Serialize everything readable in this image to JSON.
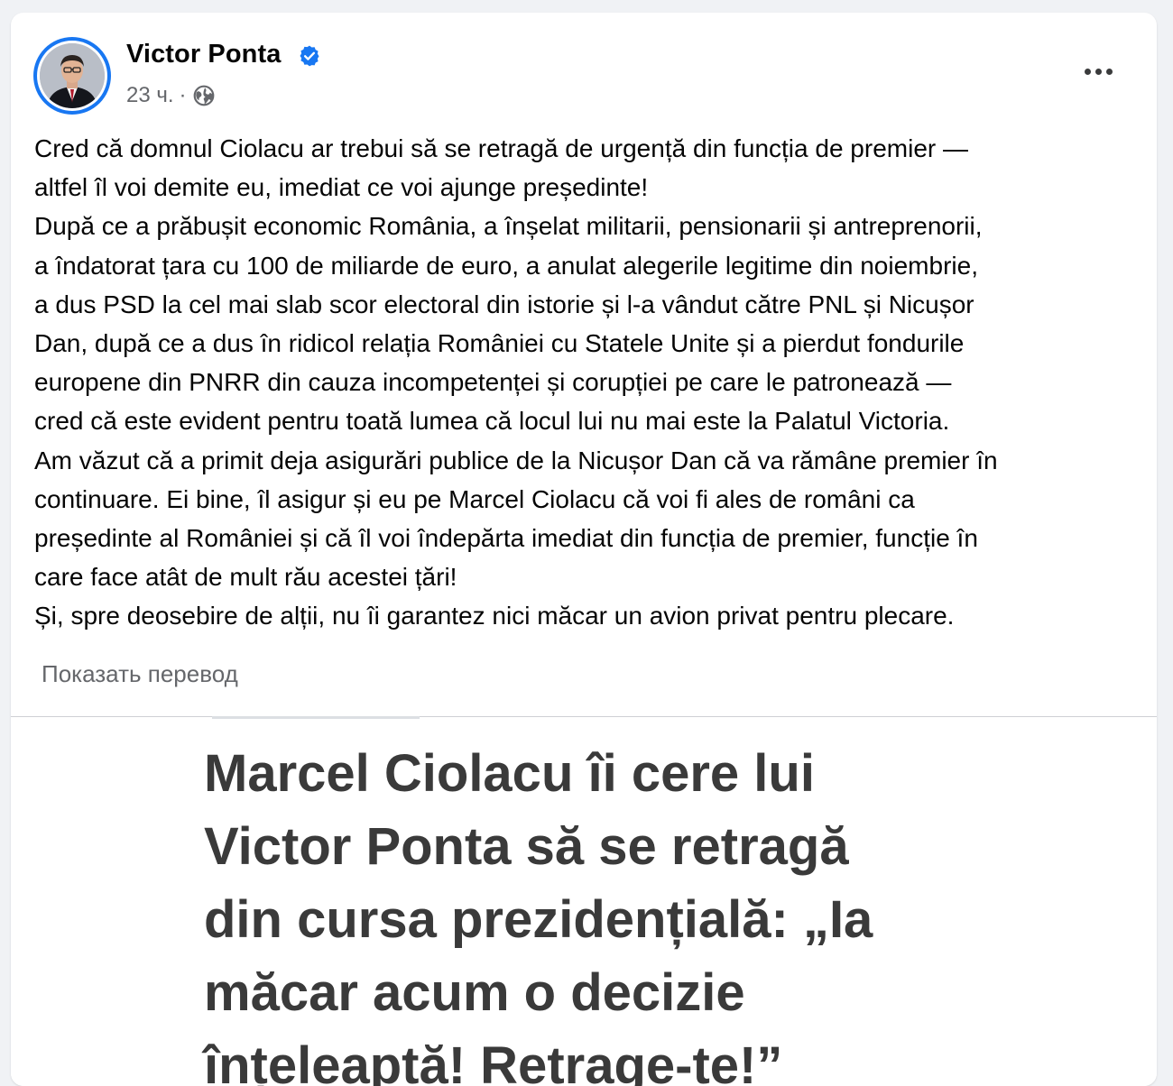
{
  "post": {
    "author": "Victor Ponta",
    "time": "23 ч.",
    "separator": "·",
    "privacy_icon": "globe-icon",
    "verified_icon": "verified-badge-icon",
    "more_icon": "more-options-icon",
    "lines": [
      "Cred că domnul Ciolacu ar trebui să se retragă de urgență din funcția de premier —",
      "altfel îl voi demite eu, imediat ce voi ajunge președinte!",
      "După ce a prăbușit economic România, a înșelat militarii, pensionarii și antreprenorii,",
      "a îndatorat țara cu 100 de miliarde de euro, a anulat alegerile legitime din noiembrie,",
      "a dus PSD la cel mai slab scor electoral din istorie și l-a vândut către PNL și Nicușor",
      "Dan, după ce a dus în ridicol relația României cu Statele Unite și a pierdut fondurile",
      "europene din PNRR din cauza incompetenței și corupției pe care le patronează —",
      "cred că este evident pentru toată lumea că locul lui nu mai este la Palatul Victoria.",
      "Am văzut că a primit deja asigurări publice de la Nicușor Dan că va rămâne premier în",
      "continuare. Ei bine, îl asigur și eu pe Marcel Ciolacu că voi fi ales de români ca",
      "președinte al României și că îl voi îndepărta imediat din funcția de premier, funcție în",
      "care face atât de mult rău acestei țări!",
      "Și, spre deosebire de alții, nu îi garantez nici măcar un avion privat pentru plecare."
    ],
    "translate_label": "Показать перевод"
  },
  "image": {
    "headline_lines": [
      "Marcel Ciolacu îi cere lui",
      "Victor Ponta să se retragă",
      "din cursa prezidențială: „Ia",
      "măcar acum o decizie",
      "înțeleaptă! Retrage-te!”"
    ]
  },
  "colors": {
    "accent": "#1877f2",
    "text": "#050505",
    "secondary": "#65676b"
  }
}
